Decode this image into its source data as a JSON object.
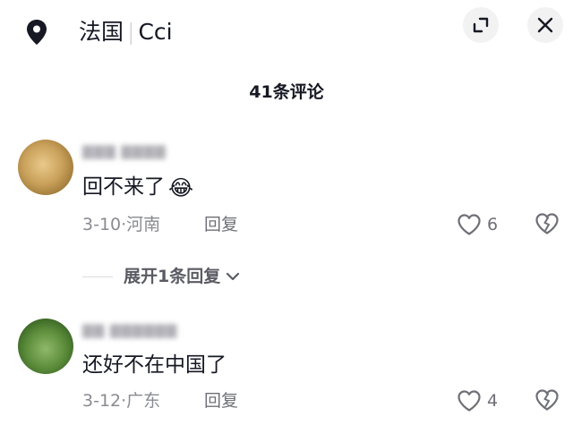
{
  "header": {
    "location_name": "法国",
    "location_separator": "|",
    "location_sub": "Cci",
    "icons": {
      "location": "location-pin-icon",
      "expand": "expand-icon",
      "close": "close-icon"
    }
  },
  "comment_count_label": "41条评论",
  "comments": [
    {
      "username": "▇▇▇ ▇▇▇▇",
      "text": "回不来了",
      "emoji": "😂",
      "date": "3-10",
      "region": "河南",
      "reply_label": "回复",
      "likes": "6",
      "expand_replies_label": "展开1条回复"
    },
    {
      "username": "▇▇ ▇▇▇▇▇▇",
      "text": "还好不在中国了",
      "date": "3-12",
      "region": "广东",
      "reply_label": "回复",
      "likes": "4"
    }
  ],
  "colors": {
    "text": "#161823",
    "muted": "#8a8b91",
    "icon": "#6f7077"
  }
}
